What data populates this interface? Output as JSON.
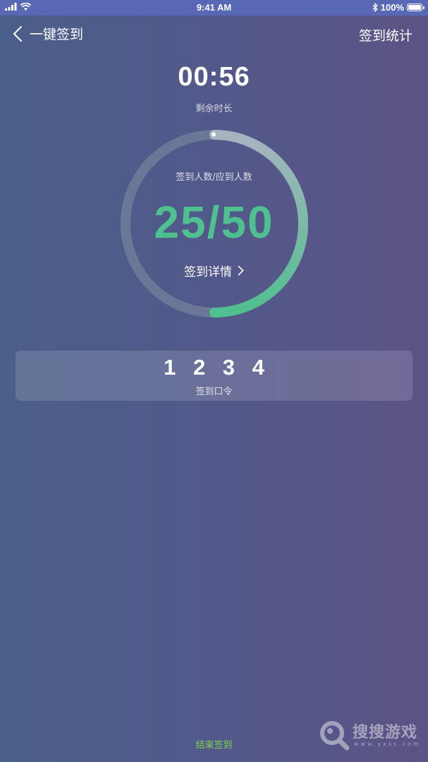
{
  "status_bar": {
    "time": "9:41 AM",
    "battery_percent": "100%",
    "battery_level": 1.0
  },
  "nav": {
    "back_icon": "chevron-left-icon",
    "title": "一键签到",
    "right_action": "签到统计"
  },
  "timer": {
    "value": "00:56",
    "label": "剩余时长"
  },
  "progress": {
    "caption": "签到人数/应到人数",
    "count_text": "25/50",
    "signed": 25,
    "expected": 50,
    "fraction": 0.5,
    "detail_label": "签到详情",
    "track_color": "#6b7796",
    "start_color": "#a7b3c0",
    "end_color": "#4fc08f"
  },
  "code": {
    "value": "1 2 3 4",
    "label": "签到口令"
  },
  "footer": {
    "end_button": "结束签到",
    "end_color": "#7ed64f"
  },
  "watermark": {
    "text": "搜搜游戏",
    "sub": "www.yxss.com"
  }
}
